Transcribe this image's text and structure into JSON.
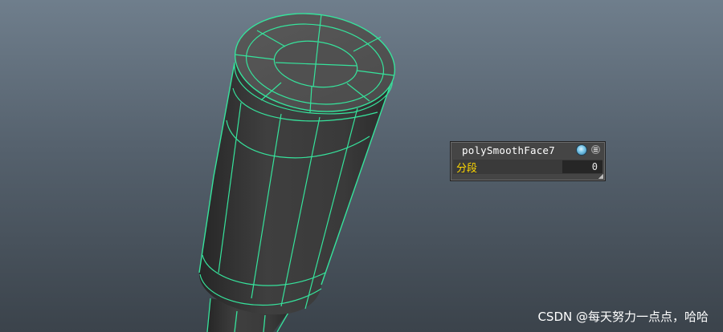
{
  "inview_editor": {
    "node_name": "polySmoothFace7",
    "node_icon": "sphere-node-icon",
    "menu_icon": "menu-icon",
    "attribute": {
      "label": "分段",
      "value": "0"
    }
  },
  "watermark": "CSDN @每天努力一点点，哈哈",
  "colors": {
    "wireframe": "#36e39c",
    "mesh_fill": "#3a3a3a",
    "label_yellow": "#ffd700"
  }
}
